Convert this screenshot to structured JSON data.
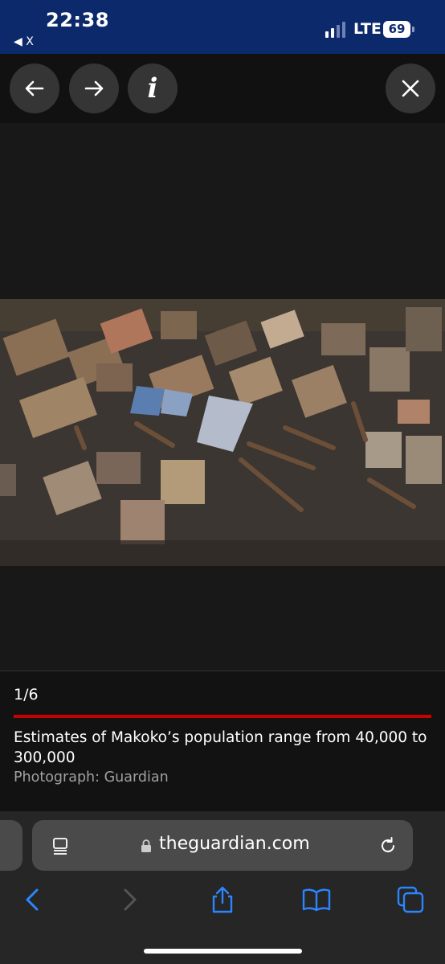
{
  "status_bar": {
    "time": "22:38",
    "back_app": "◀ X",
    "network": "LTE",
    "battery": "69"
  },
  "toolbar": {
    "prev_icon": "arrow-left-icon",
    "next_icon": "arrow-right-icon",
    "info_label": "i",
    "close_icon": "close-icon"
  },
  "gallery": {
    "counter": "1/6",
    "caption": "Estimates of Makoko’s population range from 40,000 to 300,000",
    "credit": "Photograph: Guardian",
    "accent_color": "#c70000"
  },
  "browser": {
    "url": "theguardian.com",
    "reader_icon": "reader-icon",
    "lock_icon": "lock-icon",
    "reload_icon": "reload-icon",
    "nav": [
      "back-icon",
      "forward-icon",
      "share-icon",
      "bookmarks-icon",
      "tabs-icon"
    ]
  }
}
